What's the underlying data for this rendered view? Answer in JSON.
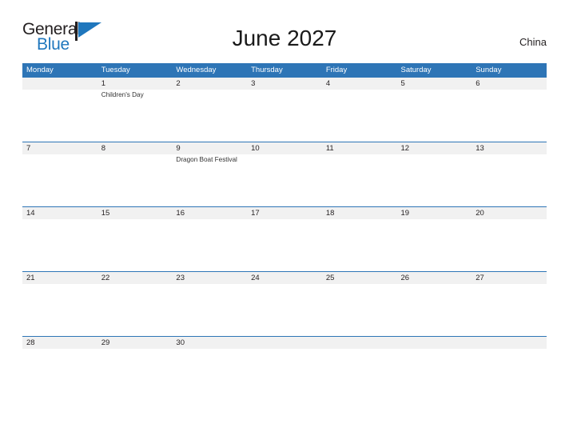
{
  "brand": {
    "name_part1": "General",
    "name_part2": "Blue",
    "flag_icon": "blue-flag-triangle-icon",
    "accent_color": "#1f77bd"
  },
  "header": {
    "title": "June 2027",
    "country": "China"
  },
  "calendar": {
    "month": "June",
    "year": "2027",
    "header_color": "#2e75b6",
    "date_band_color": "#f1f1f1",
    "weekdays": [
      "Monday",
      "Tuesday",
      "Wednesday",
      "Thursday",
      "Friday",
      "Saturday",
      "Sunday"
    ],
    "weeks": [
      {
        "days": [
          {
            "date": "",
            "events": []
          },
          {
            "date": "1",
            "events": [
              "Children's Day"
            ]
          },
          {
            "date": "2",
            "events": []
          },
          {
            "date": "3",
            "events": []
          },
          {
            "date": "4",
            "events": []
          },
          {
            "date": "5",
            "events": []
          },
          {
            "date": "6",
            "events": []
          }
        ]
      },
      {
        "days": [
          {
            "date": "7",
            "events": []
          },
          {
            "date": "8",
            "events": []
          },
          {
            "date": "9",
            "events": [
              "Dragon Boat Festival"
            ]
          },
          {
            "date": "10",
            "events": []
          },
          {
            "date": "11",
            "events": []
          },
          {
            "date": "12",
            "events": []
          },
          {
            "date": "13",
            "events": []
          }
        ]
      },
      {
        "days": [
          {
            "date": "14",
            "events": []
          },
          {
            "date": "15",
            "events": []
          },
          {
            "date": "16",
            "events": []
          },
          {
            "date": "17",
            "events": []
          },
          {
            "date": "18",
            "events": []
          },
          {
            "date": "19",
            "events": []
          },
          {
            "date": "20",
            "events": []
          }
        ]
      },
      {
        "days": [
          {
            "date": "21",
            "events": []
          },
          {
            "date": "22",
            "events": []
          },
          {
            "date": "23",
            "events": []
          },
          {
            "date": "24",
            "events": []
          },
          {
            "date": "25",
            "events": []
          },
          {
            "date": "26",
            "events": []
          },
          {
            "date": "27",
            "events": []
          }
        ]
      },
      {
        "days": [
          {
            "date": "28",
            "events": []
          },
          {
            "date": "29",
            "events": []
          },
          {
            "date": "30",
            "events": []
          },
          {
            "date": "",
            "events": []
          },
          {
            "date": "",
            "events": []
          },
          {
            "date": "",
            "events": []
          },
          {
            "date": "",
            "events": []
          }
        ]
      }
    ]
  }
}
